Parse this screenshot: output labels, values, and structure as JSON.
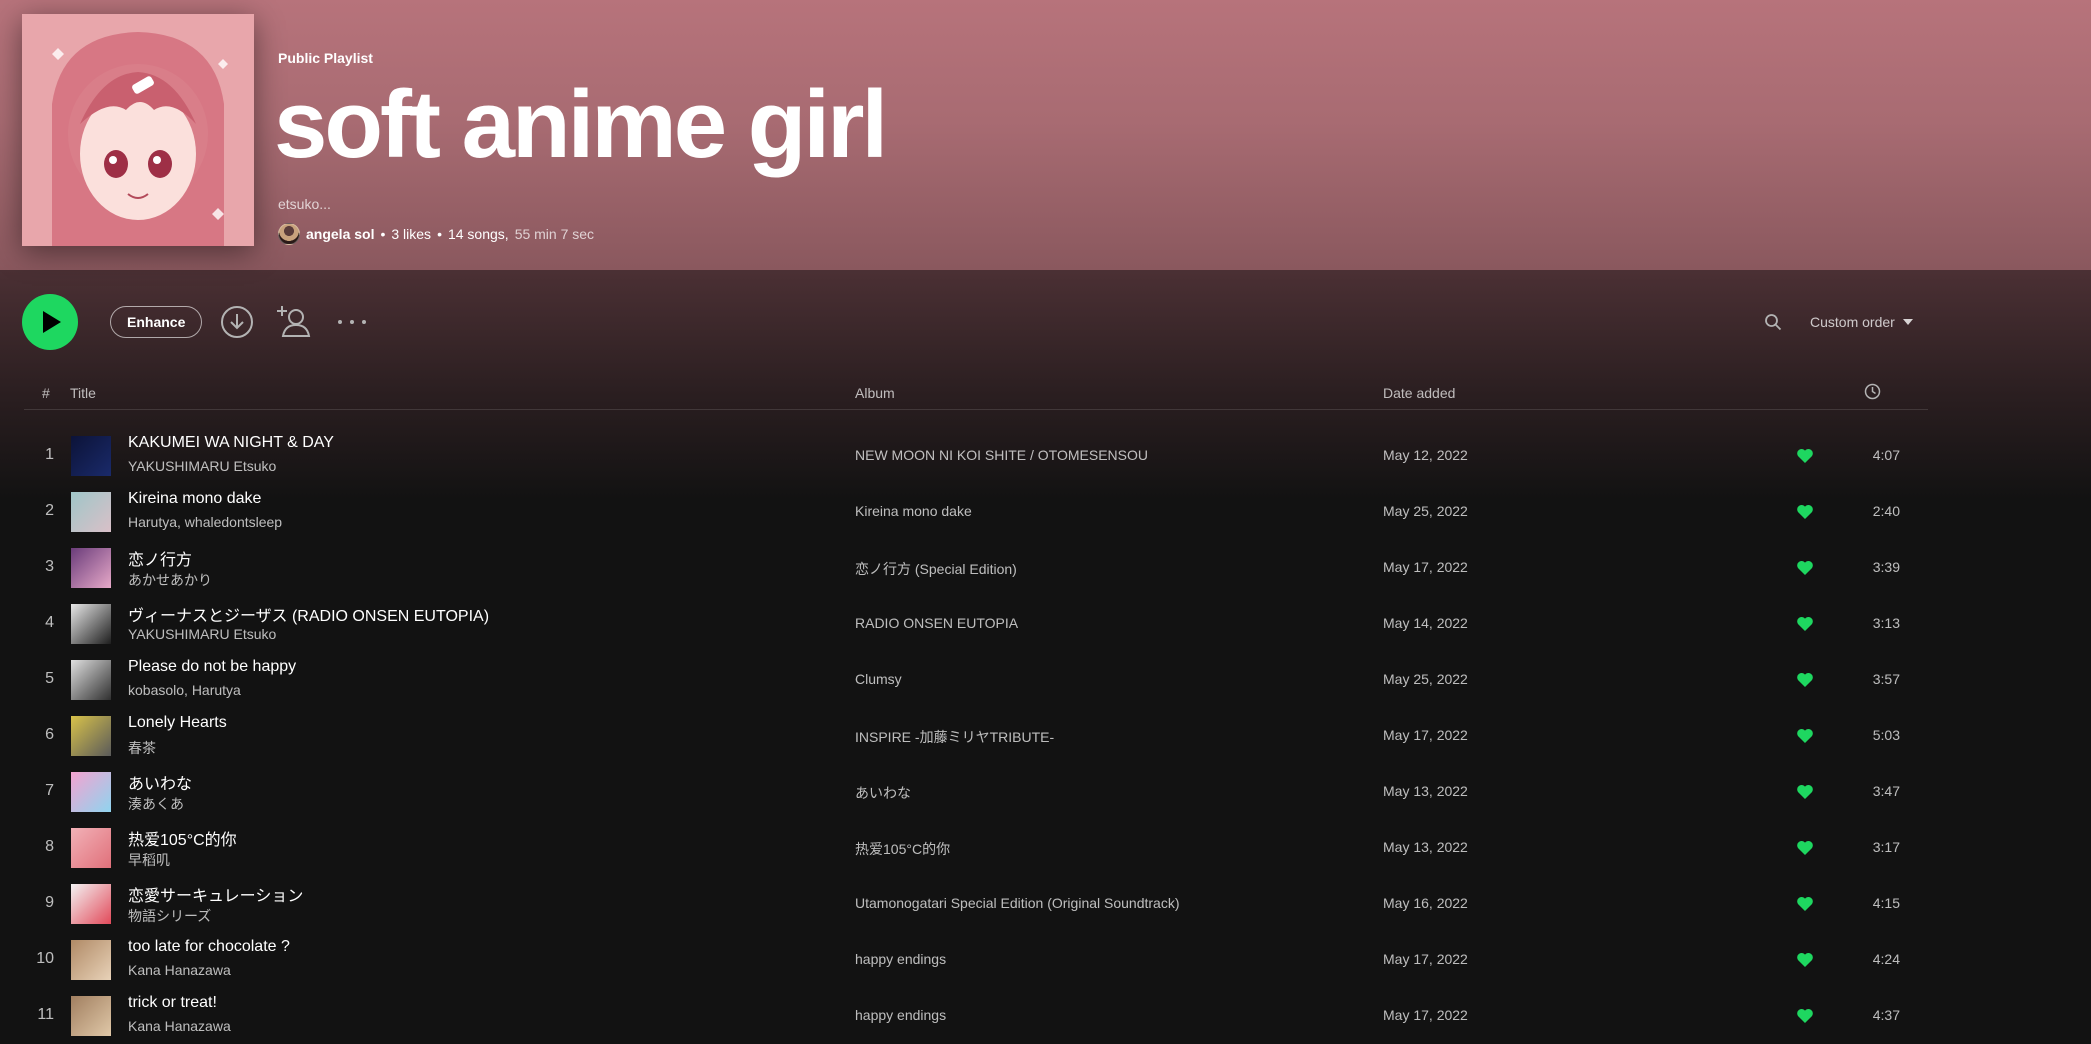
{
  "playlist": {
    "kicker": "Public Playlist",
    "title": "soft anime girl",
    "description": "etsuko...",
    "owner": "angela sol",
    "likes": "3 likes",
    "songs": "14 songs,",
    "duration": "55 min 7 sec",
    "cover_icon": "anime-girl-cover-art"
  },
  "toolbar": {
    "play_icon": "play-icon",
    "enhance_label": "Enhance",
    "download_icon": "download-icon",
    "add_user_icon": "add-user-icon",
    "more_icon": "more-icon",
    "search_icon": "search-icon",
    "sort_label": "Custom order"
  },
  "columns": {
    "num": "#",
    "title": "Title",
    "album": "Album",
    "date_added": "Date added",
    "duration_icon": "clock-icon"
  },
  "colors": {
    "accent": "#1ed760",
    "hero_top": "#b7737b",
    "background": "#121212"
  },
  "tracks": [
    {
      "num": "1",
      "title": "KAKUMEI WA NIGHT & DAY",
      "artist": "YAKUSHIMARU Etsuko",
      "album": "NEW MOON NI KOI SHITE / OTOMESENSOU",
      "date": "May 12, 2022",
      "duration": "4:07",
      "thumb_colors": [
        "#0c1338",
        "#1a2a6a"
      ]
    },
    {
      "num": "2",
      "title": "Kireina mono dake",
      "artist": "Harutya, whaledontsleep",
      "album": "Kireina mono dake",
      "date": "May 25, 2022",
      "duration": "2:40",
      "thumb_colors": [
        "#9fc6c8",
        "#d9c0c8"
      ]
    },
    {
      "num": "3",
      "title": "恋ノ行方",
      "artist": "あかせあかり",
      "album": "恋ノ行方 (Special Edition)",
      "date": "May 17, 2022",
      "duration": "3:39",
      "thumb_colors": [
        "#6a3c7a",
        "#e7a9c9"
      ]
    },
    {
      "num": "4",
      "title": "ヴィーナスとジーザス (RADIO ONSEN EUTOPIA)",
      "artist": "YAKUSHIMARU Etsuko",
      "album": "RADIO ONSEN EUTOPIA",
      "date": "May 14, 2022",
      "duration": "3:13",
      "thumb_colors": [
        "#e8e8e8",
        "#1e1e1e"
      ]
    },
    {
      "num": "5",
      "title": "Please do not be happy",
      "artist": "kobasolo, Harutya",
      "album": "Clumsy",
      "date": "May 25, 2022",
      "duration": "3:57",
      "thumb_colors": [
        "#e0e0e0",
        "#303030"
      ]
    },
    {
      "num": "6",
      "title": "Lonely Hearts",
      "artist": "春茶",
      "album": "INSPIRE -加藤ミリヤTRIBUTE-",
      "date": "May 17, 2022",
      "duration": "5:03",
      "thumb_colors": [
        "#d8c24a",
        "#5a5a5a"
      ]
    },
    {
      "num": "7",
      "title": "あいわな",
      "artist": "湊あくあ",
      "album": "あいわな",
      "date": "May 13, 2022",
      "duration": "3:47",
      "thumb_colors": [
        "#f4a3d0",
        "#8fd4ef"
      ]
    },
    {
      "num": "8",
      "title": "热爱105°C的你",
      "artist": "早稻叽",
      "album": "热爱105°C的你",
      "date": "May 13, 2022",
      "duration": "3:17",
      "thumb_colors": [
        "#f2b1b7",
        "#e0707a"
      ]
    },
    {
      "num": "9",
      "title": "恋愛サーキュレーション",
      "artist": "物語シリーズ",
      "album": "Utamonogatari Special Edition (Original Soundtrack)",
      "date": "May 16, 2022",
      "duration": "4:15",
      "thumb_colors": [
        "#f3f3f3",
        "#e24a5a"
      ]
    },
    {
      "num": "10",
      "title": "too late for chocolate ?",
      "artist": "Kana Hanazawa",
      "album": "happy endings",
      "date": "May 17, 2022",
      "duration": "4:24",
      "thumb_colors": [
        "#b08a66",
        "#e8d2b8"
      ]
    },
    {
      "num": "11",
      "title": "trick or treat!",
      "artist": "Kana Hanazawa",
      "album": "happy endings",
      "date": "May 17, 2022",
      "duration": "4:37",
      "thumb_colors": [
        "#a17f60",
        "#e0c8a8"
      ]
    }
  ]
}
